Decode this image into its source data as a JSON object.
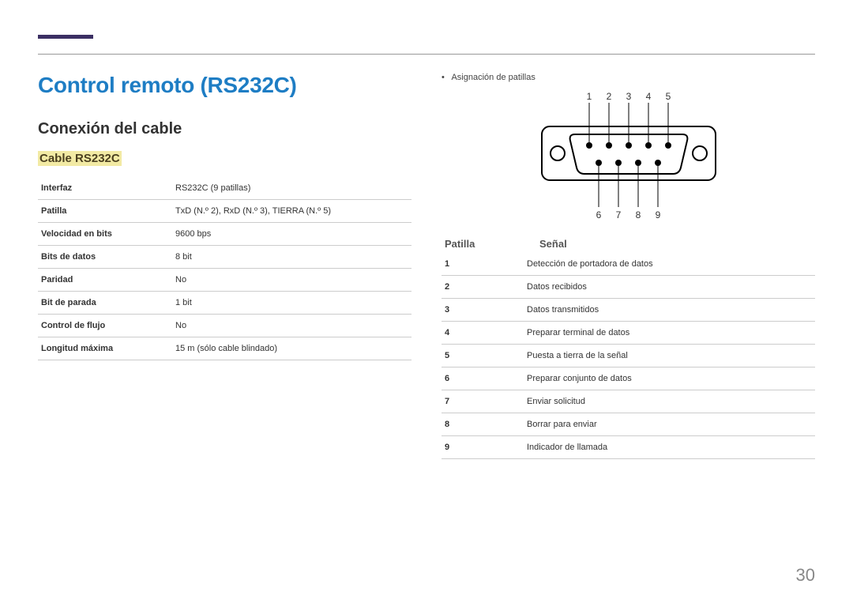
{
  "title": "Control remoto (RS232C)",
  "section": "Conexión del cable",
  "subsection": "Cable RS232C",
  "spec": {
    "rows": [
      {
        "k": "Interfaz",
        "v": "RS232C (9 patillas)"
      },
      {
        "k": "Patilla",
        "v": "TxD (N.º 2), RxD (N.º 3), TIERRA (N.º 5)"
      },
      {
        "k": "Velocidad en bits",
        "v": "9600 bps"
      },
      {
        "k": "Bits de datos",
        "v": "8 bit"
      },
      {
        "k": "Paridad",
        "v": "No"
      },
      {
        "k": "Bit de parada",
        "v": "1 bit"
      },
      {
        "k": "Control de flujo",
        "v": "No"
      },
      {
        "k": "Longitud máxima",
        "v": "15 m (sólo cable blindado)"
      }
    ]
  },
  "right": {
    "bullet": "Asignación de patillas",
    "top_labels": [
      "1",
      "2",
      "3",
      "4",
      "5"
    ],
    "bottom_labels": [
      "6",
      "7",
      "8",
      "9"
    ],
    "header_pin": "Patilla",
    "header_sig": "Señal",
    "pins": [
      {
        "n": "1",
        "s": "Detección de portadora de datos"
      },
      {
        "n": "2",
        "s": "Datos recibidos"
      },
      {
        "n": "3",
        "s": "Datos transmitidos"
      },
      {
        "n": "4",
        "s": "Preparar terminal de datos"
      },
      {
        "n": "5",
        "s": "Puesta a tierra de la señal"
      },
      {
        "n": "6",
        "s": "Preparar conjunto de datos"
      },
      {
        "n": "7",
        "s": "Enviar solicitud"
      },
      {
        "n": "8",
        "s": "Borrar para enviar"
      },
      {
        "n": "9",
        "s": "Indicador de llamada"
      }
    ]
  },
  "page_number": "30"
}
